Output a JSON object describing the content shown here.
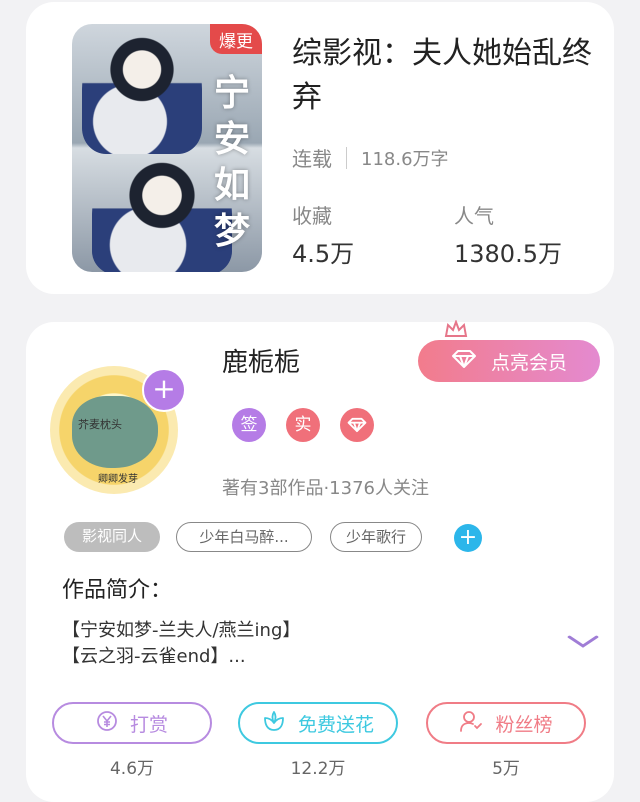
{
  "book": {
    "cover_badge": "爆更",
    "cover_title_art": "宁安如梦",
    "title": "综影视：夫人她始乱终弃",
    "status": "连载",
    "word_count": "118.6万字",
    "favorites_label": "收藏",
    "favorites_value": "4.5万",
    "popularity_label": "人气",
    "popularity_value": "1380.5万"
  },
  "author": {
    "avatar_text_top": "芥麦枕头",
    "avatar_text_bottom": "卿卿发芽",
    "name": "鹿栀栀",
    "vip_button_label": "点亮会员",
    "badges": [
      {
        "label": "签",
        "color": "#b57ce6"
      },
      {
        "label": "实",
        "color": "#f0707a"
      },
      {
        "label": "◇",
        "color": "#f0707a"
      }
    ],
    "stats": "著有3部作品·1376人关注",
    "tags": [
      "影视同人",
      "少年白马醉...",
      "少年歌行"
    ],
    "intro_title": "作品简介：",
    "intro_lines": [
      "【宁安如梦-兰夫人/燕兰ing】",
      "【云之羽-云雀end】..."
    ]
  },
  "actions": [
    {
      "label": "打赏",
      "count": "4.6万",
      "color": "#b78be0",
      "icon": "yen-coin-icon"
    },
    {
      "label": "免费送花",
      "count": "12.2万",
      "color": "#3ec9e0",
      "icon": "flower-icon"
    },
    {
      "label": "粉丝榜",
      "count": "5万",
      "color": "#f07c86",
      "icon": "fan-user-icon"
    }
  ],
  "colors": {
    "accent_purple": "#b57ce6",
    "accent_pink": "#f27c8c",
    "accent_cyan": "#2cb6ea"
  }
}
